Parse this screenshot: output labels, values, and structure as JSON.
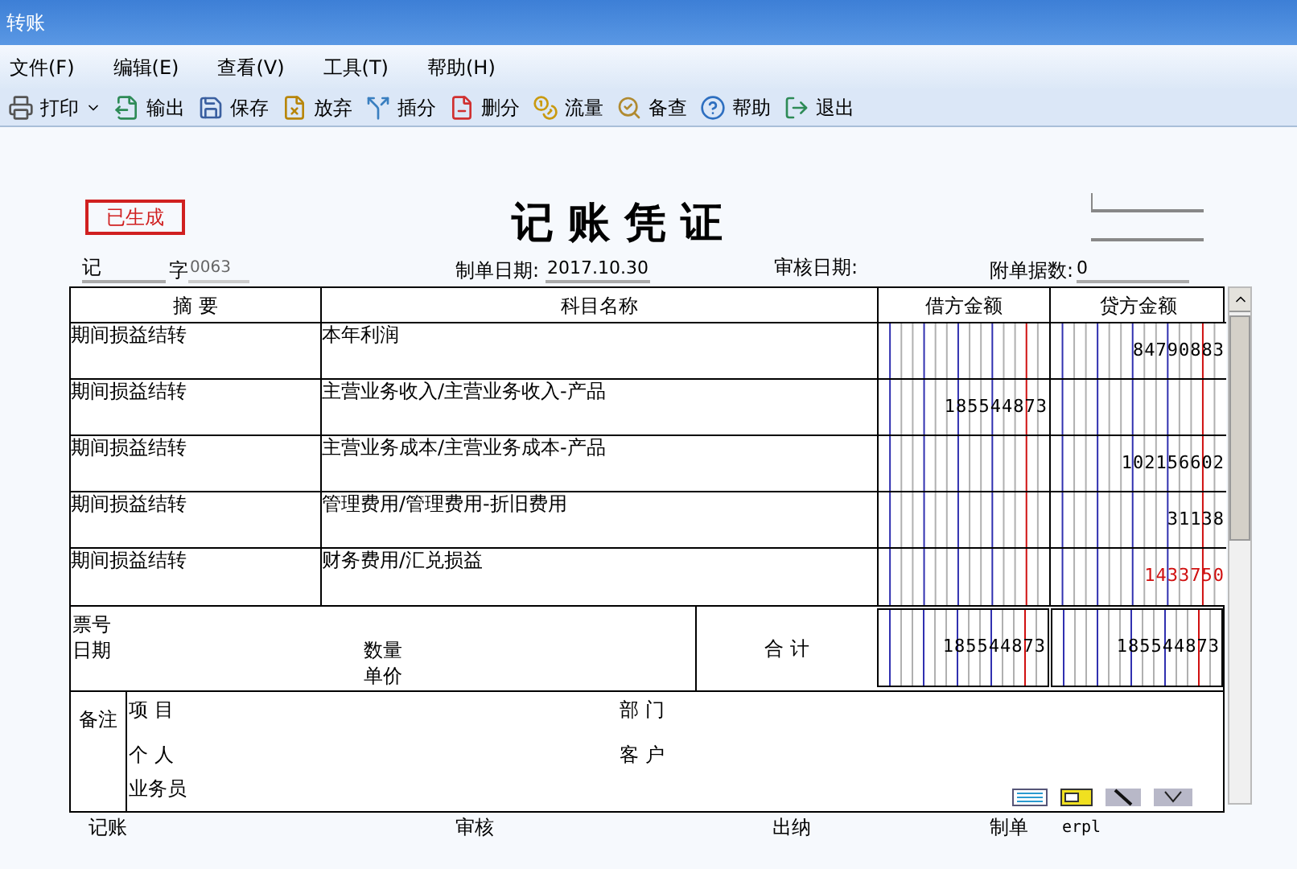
{
  "window": {
    "title": "转账"
  },
  "menu": [
    {
      "label": "文件(F)"
    },
    {
      "label": "编辑(E)"
    },
    {
      "label": "查看(V)"
    },
    {
      "label": "工具(T)"
    },
    {
      "label": "帮助(H)"
    }
  ],
  "toolbar": [
    {
      "label": "打印",
      "dropdown": true
    },
    {
      "label": "输出",
      "dropdown": false
    },
    {
      "label": "保存",
      "dropdown": false
    },
    {
      "label": "放弃",
      "dropdown": false
    },
    {
      "label": "插分",
      "dropdown": false
    },
    {
      "label": "删分",
      "dropdown": false
    },
    {
      "label": "流量",
      "dropdown": false
    },
    {
      "label": "备查",
      "dropdown": false
    },
    {
      "label": "帮助",
      "dropdown": false
    },
    {
      "label": "退出",
      "dropdown": false
    }
  ],
  "voucher": {
    "status": "已生成",
    "title": "记 账 凭 证",
    "type_label": "记",
    "number_label": "字",
    "number": "0063",
    "date_label": "制单日期:",
    "date": "2017.10.30",
    "audit_date_label": "审核日期:",
    "attachments_label": "附单据数:",
    "attachments": "0"
  },
  "table": {
    "columns": [
      "摘 要",
      "科目名称",
      "借方金额",
      "贷方金额"
    ],
    "rows": [
      {
        "summary": "期间损益结转",
        "account": "本年利润",
        "debit": "",
        "credit": "84790883",
        "negative": false
      },
      {
        "summary": "期间损益结转",
        "account": "主营业务收入/主营业务收入-产品",
        "debit": "185544873",
        "credit": "",
        "negative": false
      },
      {
        "summary": "期间损益结转",
        "account": "主营业务成本/主营业务成本-产品",
        "debit": "",
        "credit": "102156602",
        "negative": false
      },
      {
        "summary": "期间损益结转",
        "account": "管理费用/管理费用-折旧费用",
        "debit": "",
        "credit": "31138",
        "negative": false
      },
      {
        "summary": "期间损益结转",
        "account": "财务费用/汇兑损益",
        "debit": "",
        "credit": "1433750",
        "negative": true
      }
    ]
  },
  "totals": {
    "ticket_label": "票号",
    "date_label": "日期",
    "quantity_label": "数量",
    "price_label": "单价",
    "total_label": "合 计",
    "debit": "185544873",
    "credit": "185544873"
  },
  "notes": {
    "label": "备注",
    "project_label": "项 目",
    "department_label": "部 门",
    "person_label": "个 人",
    "customer_label": "客 户",
    "salesperson_label": "业务员"
  },
  "signatures": {
    "bookkeeper_label": "记账",
    "auditor_label": "审核",
    "cashier_label": "出纳",
    "maker_label": "制单",
    "maker": "erpl"
  }
}
